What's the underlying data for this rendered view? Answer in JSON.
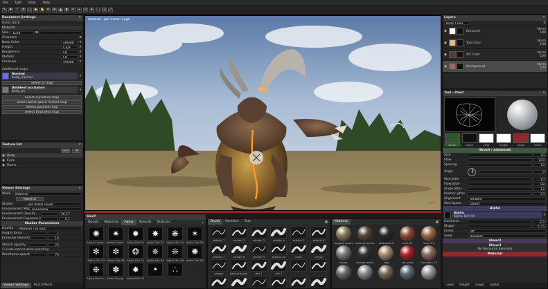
{
  "menu": [
    "File",
    "Edit",
    "View",
    "Help"
  ],
  "toolbar": {
    "tools": [
      "✎",
      "✚",
      "⟋",
      "◔",
      "▢",
      "◆",
      "✋",
      "⟲",
      "⊕",
      "▲",
      "◐",
      "✂",
      "⌖",
      "⊙",
      "✦",
      "⬚",
      "◫",
      "⤢"
    ]
  },
  "doc": {
    "header": "Document Settings",
    "undo_stack": "Undo stack",
    "material": "Material",
    "size_label": "Size",
    "size_value": "1024",
    "channels_label": "Channels",
    "channels": [
      {
        "name": "Base Color",
        "fmt": "sRGB8"
      },
      {
        "name": "Height",
        "fmt": "L32F"
      },
      {
        "name": "Roughness",
        "fmt": "L8"
      },
      {
        "name": "Metallic",
        "fmt": "L8"
      },
      {
        "name": "Emissive",
        "fmt": "sRGB8"
      }
    ],
    "additional_maps": "Additional maps",
    "normal_title": "Normal",
    "normal_file": "body_normal",
    "normal_button": "Select nl map",
    "ao_title": "Ambient occlusion",
    "ao_file": "body_ao",
    "map_buttons": [
      "Select curvature map",
      "Select world space normal map",
      "Select position map",
      "Select thickness map"
    ]
  },
  "textures": {
    "header": "Texture list",
    "solo": "Solo",
    "all": "All",
    "items": [
      "Body",
      "Eyes",
      "Horns"
    ]
  },
  "viewer": {
    "header": "Viewer Settings",
    "mode_label": "Mode",
    "mode_value": "Material",
    "material_btn": "Material",
    "shader_label": "Shader",
    "shader_value": "pbr metal rough",
    "env_map_label": "Environment Map",
    "env_map_value": "panorama",
    "env_opacity_label": "Environment Opacity",
    "env_opacity_value": "56.57",
    "env_exposure_label": "Environment Exposure (EV)",
    "env_exposure_value": "0.1",
    "shader_params": "Shader Parameters",
    "quality_label": "Quality",
    "quality_value": "Medium (16 spp)",
    "height_force_label": "Height force",
    "height_force_value": "1",
    "emissive_label": "Emissive Intensity",
    "emissive_value": "10",
    "stencil_label": "Stencil opacity",
    "stencil_value": "25",
    "hide_stencil": "Hide stencil when painting",
    "wire_label": "Wireframe opacity",
    "wire_value": "70",
    "tabs": [
      "Viewer Settings",
      "Post Effects"
    ]
  },
  "viewport": {
    "label": "Material - pbr metal rough"
  },
  "shelf": {
    "header": "Shelf",
    "tabs": [
      "Decals",
      "Materials",
      "Alpha",
      "Stencils",
      "Textures"
    ],
    "active_tab": "Alpha",
    "alphas": [
      "Alpha Cracks...",
      "Alpha Cracks...",
      "Alpha Dirt 01",
      "Alpha Dirt 03",
      "Alpha Dirt 04",
      "Alpha Dirt 06",
      "Alpha Dirt 07",
      "Alpha Dirt 08",
      "Alpha Dirt 10",
      "Alpha Dirt 04",
      "Alpha Dirt 06",
      "Alpha Dirt 08",
      "Alpha Grunin...",
      "Alpha Grungl...",
      "Alpha Dirt 03",
      "",
      ""
    ]
  },
  "brush": {
    "tabs": [
      "Brush",
      "Particles",
      "Tool"
    ],
    "items": [
      "artistic 1",
      "artistic 2",
      "artistic 3",
      "artistic 4",
      "artistic 5",
      "artistic 6",
      "artistic 7",
      "artistic 8",
      "artistic 9",
      "artistic 10",
      "celtic",
      "crayon",
      "crayon",
      "default brush",
      "dirt 1",
      "dirt 2",
      "",
      "",
      "",
      "",
      "",
      "",
      "",
      ""
    ]
  },
  "matshelf": {
    "tab": "Material",
    "items": [
      "bagged paper",
      "bark old grass",
      "blackbeard",
      "brick 01",
      "brick 03",
      "bump",
      "carmer black",
      "clay",
      "car paint",
      "Carmenn 03",
      "",
      "",
      "",
      "",
      ""
    ]
  },
  "layers": {
    "header": "Layers",
    "blend_label": "Base Color",
    "items": [
      {
        "name": "Emissive",
        "mode": "Norm",
        "op": "100",
        "color": "#ffffff"
      },
      {
        "name": "Top Color",
        "mode": "Norm",
        "op": "100",
        "color": "#e6b982"
      },
      {
        "name": "AO Color",
        "mode": "Norm",
        "op": "100",
        "color": "#5a3a2a"
      },
      {
        "name": "Background",
        "mode": "Norm",
        "op": "100",
        "color": "#9a6a5a"
      }
    ]
  },
  "tool": {
    "header": "Tool - Paint",
    "swatch_labels": [
      "brush",
      "alpha",
      "color",
      "height",
      "rough",
      "metal"
    ],
    "brush_adv": "Brush : advanced",
    "params": [
      {
        "label": "Size",
        "value": "20"
      },
      {
        "label": "Flow",
        "value": "100"
      },
      {
        "label": "Spacing",
        "value": "10"
      }
    ],
    "angle_label": "Angle",
    "angle_value": "0",
    "jitters": [
      {
        "label": "Size Jitter",
        "value": "10"
      },
      {
        "label": "Flow Jitter",
        "value": "98"
      },
      {
        "label": "Angle Jitter",
        "value": "12"
      },
      {
        "label": "Position Jitter",
        "value": "23"
      }
    ],
    "alignment_label": "Alignment",
    "alignment_value": "Tangent",
    "size_space_label": "Size Space",
    "size_space_value": "Object",
    "alpha_section": "Alpha",
    "alpha_name": "Alpha",
    "alpha_file": "Alpha Dirt 06",
    "hardness_label": "Hardness",
    "hardness_value": "0.5",
    "shape_label": "Shape",
    "shape_value": "0.75",
    "invert_label": "Invert",
    "invert_value": "Off",
    "seed_label": "Seed",
    "seed_value": "Random",
    "stencil": "Stencil",
    "stencil_title": "Stencil",
    "stencil_none": "No Resource Selected",
    "material": "Material",
    "bottom_tabs": [
      "color",
      "height",
      "rough",
      "metal"
    ]
  }
}
